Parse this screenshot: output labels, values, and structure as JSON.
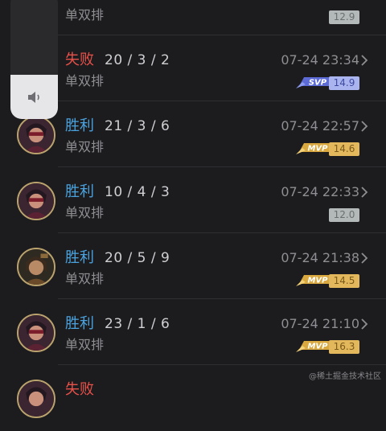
{
  "matches": [
    {
      "result": "",
      "result_type": "win",
      "kda": "",
      "mode": "单双排",
      "time": "",
      "badge": "",
      "score": "12.9",
      "score_style": "grey",
      "avatar": "champion-portrait"
    },
    {
      "result": "失败",
      "result_type": "loss",
      "kda": "20 / 3 / 2",
      "mode": "单双排",
      "time": "07-24 23:34",
      "badge": "SVP",
      "score": "14.9",
      "score_style": "blue",
      "avatar": ""
    },
    {
      "result": "胜利",
      "result_type": "win",
      "kda": "21 / 3 / 6",
      "mode": "单双排",
      "time": "07-24 22:57",
      "badge": "MVP",
      "score": "14.6",
      "score_style": "gold",
      "avatar": "champion-portrait"
    },
    {
      "result": "胜利",
      "result_type": "win",
      "kda": "10 / 4 / 3",
      "mode": "单双排",
      "time": "07-24 22:33",
      "badge": "",
      "score": "12.0",
      "score_style": "grey",
      "avatar": "champion-portrait"
    },
    {
      "result": "胜利",
      "result_type": "win",
      "kda": "20 / 5 / 9",
      "mode": "单双排",
      "time": "07-24 21:38",
      "badge": "MVP",
      "score": "14.5",
      "score_style": "gold",
      "avatar": "champion-portrait-alt"
    },
    {
      "result": "胜利",
      "result_type": "win",
      "kda": "23 / 1 / 6",
      "mode": "单双排",
      "time": "07-24 21:10",
      "badge": "MVP",
      "score": "16.3",
      "score_style": "gold",
      "avatar": "champion-portrait"
    },
    {
      "result": "失败",
      "result_type": "loss",
      "kda": "",
      "mode": "",
      "time": "",
      "badge": "",
      "score": "",
      "score_style": "grey",
      "avatar": "champion-portrait"
    }
  ],
  "volume": {
    "level_percent": 35,
    "icon": "speaker-icon"
  },
  "watermark": "@稀土掘金技术社区",
  "colors": {
    "win": "#4aa3df",
    "loss": "#e8504a",
    "background": "#1c1c1e",
    "mvp": "#e3b75b",
    "svp": "#6f7fe0"
  }
}
